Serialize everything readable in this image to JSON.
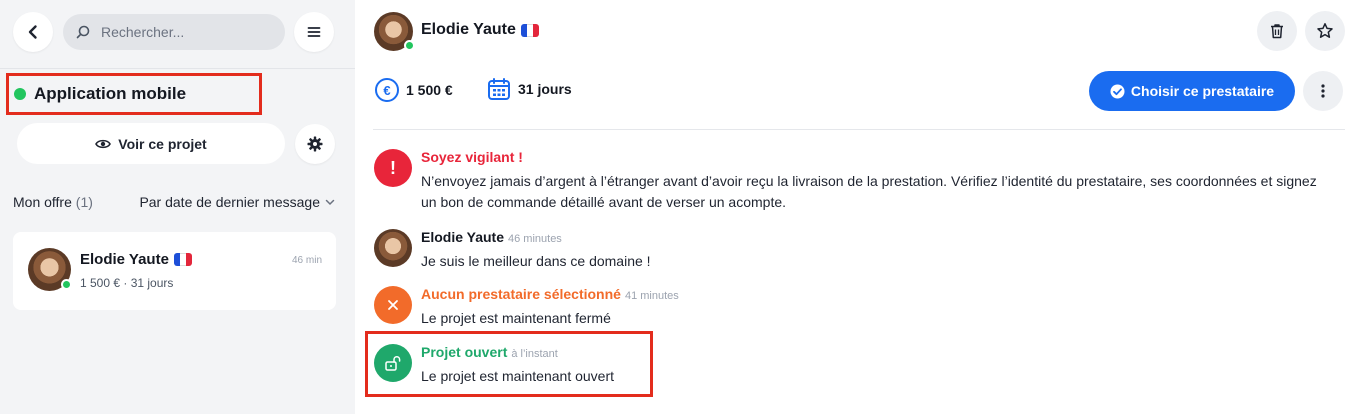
{
  "sidebar": {
    "search": {
      "placeholder": "Rechercher..."
    },
    "project": {
      "title": "Application mobile",
      "status_color": "#22c55e"
    },
    "view_project_label": "Voir ce projet",
    "offers": {
      "label": "Mon offre",
      "count": "(1)",
      "sort_label": "Par date de dernier message"
    },
    "card": {
      "name": "Elodie Yaute",
      "time": "46 min",
      "meta": "1 500 € · 31 jours"
    }
  },
  "header": {
    "name": "Elodie Yaute"
  },
  "summary": {
    "price": "1 500 €",
    "duration": "31 jours"
  },
  "actions": {
    "choose_label": "Choisir ce prestataire"
  },
  "messages": {
    "warning": {
      "title": "Soyez vigilant !",
      "body": "N’envoyez jamais d’argent à l’étranger avant d’avoir reçu la livraison de la prestation. Vérifiez l’identité du prestataire, ses coordonnées et signez un bon de commande détaillé avant de verser un acompte."
    },
    "chat": {
      "author": "Elodie Yaute",
      "time": "46 minutes",
      "body": "Je suis le meilleur dans ce domaine !"
    },
    "closed": {
      "title": "Aucun prestataire sélectionné",
      "time": "41 minutes",
      "body": "Le projet est maintenant fermé"
    },
    "opened": {
      "title": "Projet ouvert",
      "time": "à l’instant",
      "body": "Le projet est maintenant ouvert"
    }
  },
  "colors": {
    "accent": "#1a6cf0",
    "danger": "#e8253a",
    "warning_orange": "#f26b2a",
    "success": "#1fa86b",
    "highlight_frame": "#e32c1d"
  },
  "icons": [
    "back-icon",
    "search-icon",
    "menu-icon",
    "eye-icon",
    "gear-icon",
    "chevron-down-icon",
    "flag-fr-icon",
    "trash-icon",
    "star-icon",
    "euro-icon",
    "calendar-icon",
    "check-circle-icon",
    "more-vertical-icon",
    "exclamation-icon",
    "close-icon",
    "unlock-icon"
  ]
}
